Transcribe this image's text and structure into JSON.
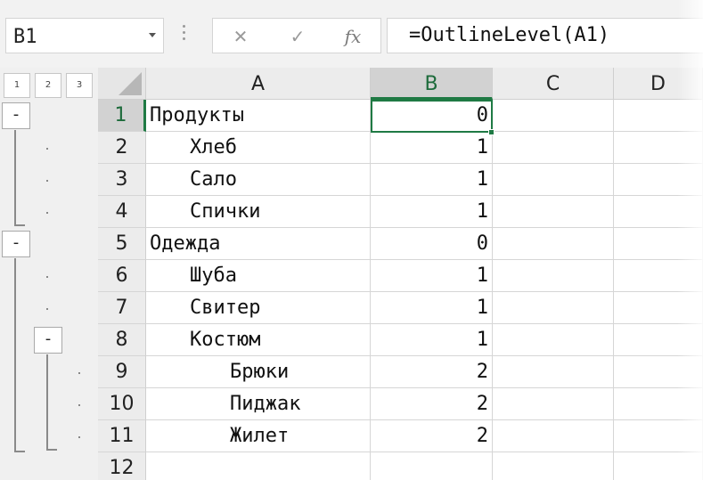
{
  "name_box": {
    "value": "B1"
  },
  "formula_bar": {
    "cancel_glyph": "✕",
    "enter_glyph": "✓",
    "function_glyph": "fx",
    "formula": "=OutlineLevel(A1)"
  },
  "outline": {
    "level_buttons": [
      "1",
      "2",
      "3"
    ],
    "collapse_glyph": "-"
  },
  "columns": [
    "A",
    "B",
    "C",
    "D"
  ],
  "rows": [
    {
      "num": "1",
      "a": "Продукты",
      "b": "0",
      "indent": 0
    },
    {
      "num": "2",
      "a": "Хлеб",
      "b": "1",
      "indent": 1
    },
    {
      "num": "3",
      "a": "Сало",
      "b": "1",
      "indent": 1
    },
    {
      "num": "4",
      "a": "Спички",
      "b": "1",
      "indent": 1
    },
    {
      "num": "5",
      "a": "Одежда",
      "b": "0",
      "indent": 0
    },
    {
      "num": "6",
      "a": "Шуба",
      "b": "1",
      "indent": 1
    },
    {
      "num": "7",
      "a": "Свитер",
      "b": "1",
      "indent": 1
    },
    {
      "num": "8",
      "a": "Костюм",
      "b": "1",
      "indent": 1
    },
    {
      "num": "9",
      "a": "Брюки",
      "b": "2",
      "indent": 2
    },
    {
      "num": "10",
      "a": "Пиджак",
      "b": "2",
      "indent": 2
    },
    {
      "num": "11",
      "a": "Жилет",
      "b": "2",
      "indent": 2
    },
    {
      "num": "12",
      "a": "",
      "b": "",
      "indent": 0
    }
  ],
  "selection": {
    "column": "B",
    "row": "1"
  },
  "colors": {
    "accent": "#1f7a44"
  }
}
